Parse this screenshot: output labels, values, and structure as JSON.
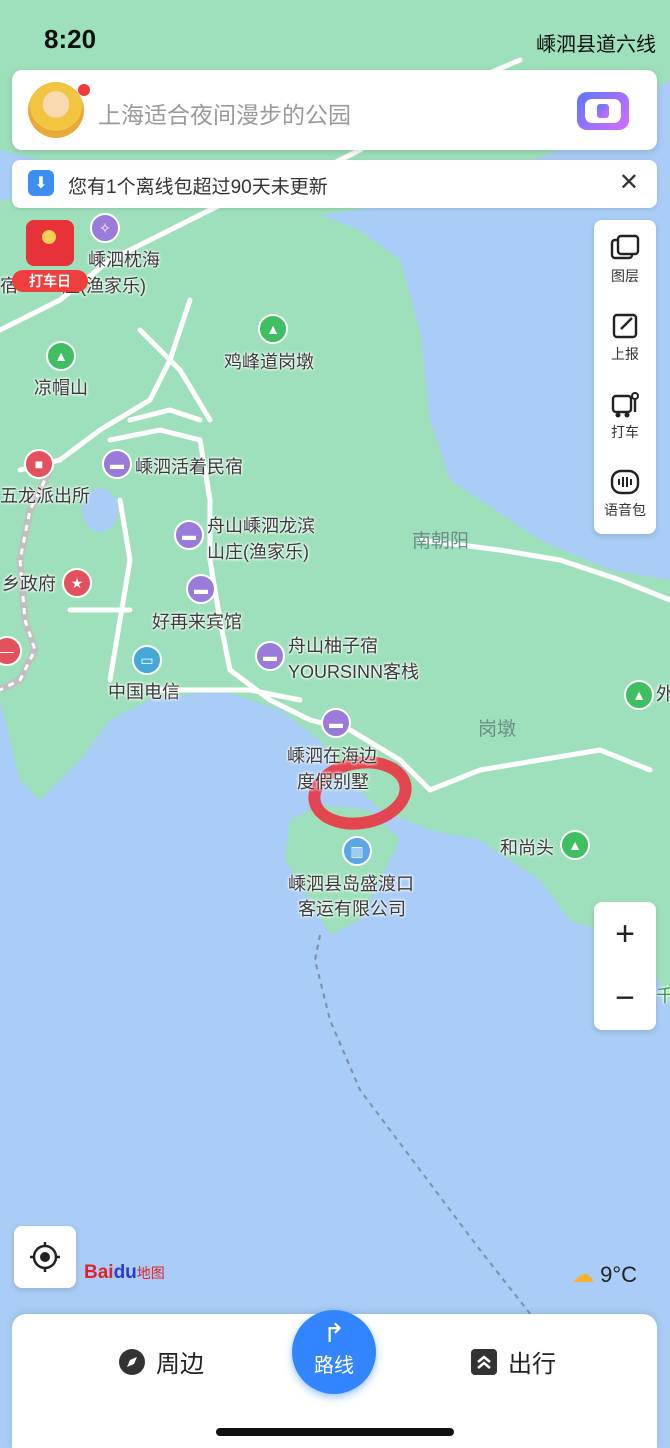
{
  "status_bar": {
    "time": "8:20",
    "right_text": "嵊泗县道六线"
  },
  "search": {
    "placeholder": "上海适合夜间漫步的公园"
  },
  "notice": {
    "text": "您有1个离线包超过90天未更新"
  },
  "redpacket": {
    "tag": "打车日"
  },
  "toolbar": {
    "layers": "图层",
    "report": "上报",
    "taxi": "打车",
    "voice_pack": "语音包"
  },
  "map": {
    "labels": {
      "zhenhai": "嵊泗枕海",
      "zhenhai2": "庄(渔家乐)",
      "left_cut": "宿",
      "jifeng": "鸡峰道岗墩",
      "liangmao": "凉帽山",
      "huozhe": "嵊泗活着民宿",
      "wulong": "五龙派出所",
      "longbin1": "舟山嵊泗龙滨",
      "longbin2": "山庄(渔家乐)",
      "xiangzhengfu": "乡政府",
      "nanchaoyang": "南朝阳",
      "haozailai": "好再来宾馆",
      "youzi1": "舟山柚子宿",
      "youzi2": "YOURSINN客栈",
      "dianxin": "中国电信",
      "gangdun": "岗墩",
      "zaihaibian1": "嵊泗在海边",
      "zaihaibian2": "度假别墅",
      "heshangtou": "和尚头",
      "ferry1": "嵊泗县岛盛渡口",
      "ferry2": "客运有限公司",
      "right_cut": "外",
      "right_cut2": "千"
    }
  },
  "zoom": {
    "in": "+",
    "out": "−"
  },
  "logo": {
    "bai": "Bai",
    "du": "du",
    "cn": "地图"
  },
  "weather": {
    "temp": "9°C"
  },
  "bottom": {
    "nearby": "周边",
    "route": "路线",
    "travel": "出行"
  }
}
